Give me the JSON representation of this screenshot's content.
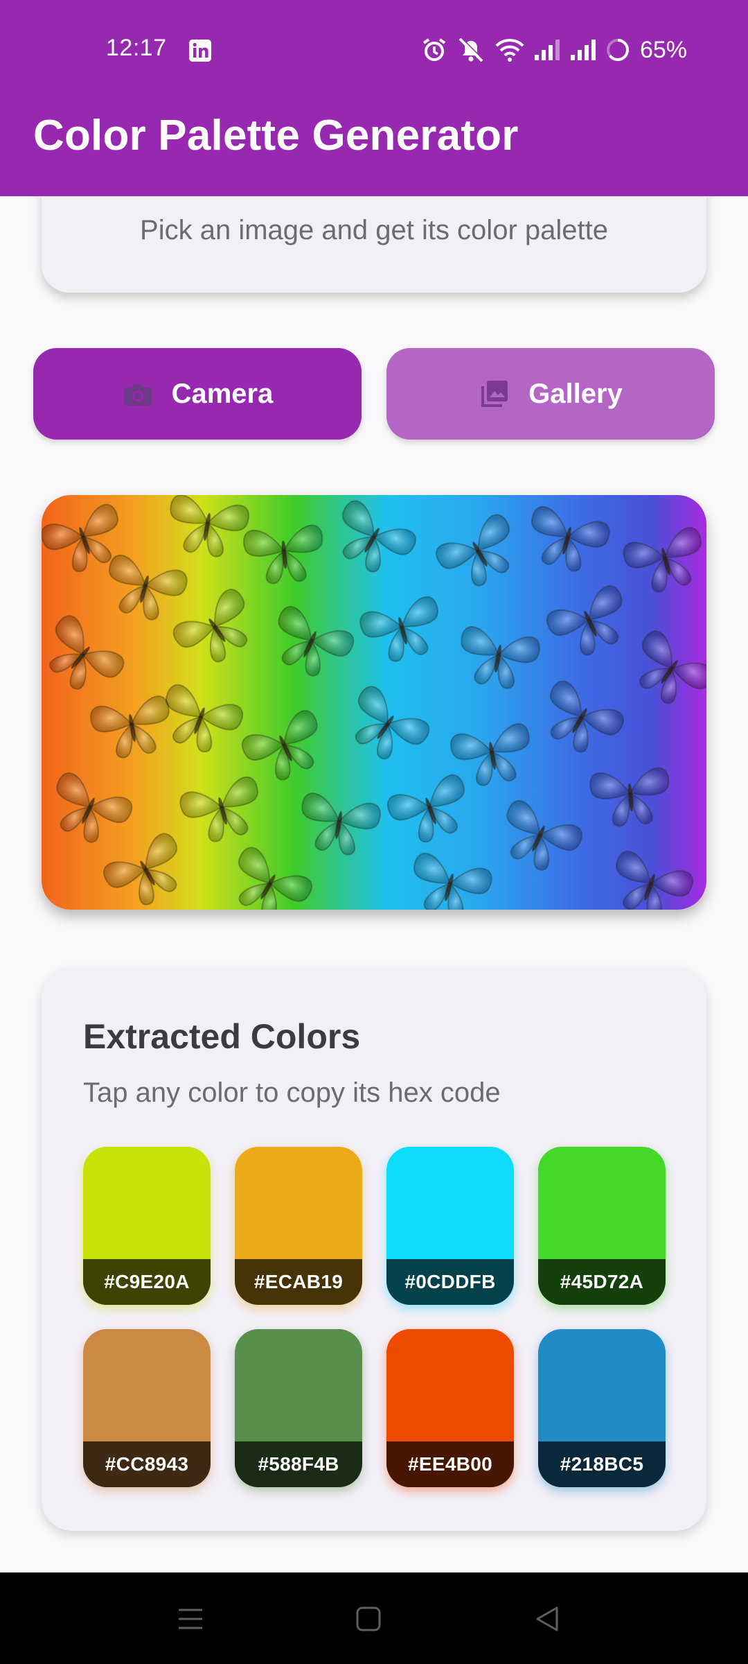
{
  "status_bar": {
    "time": "12:17",
    "battery": "65%"
  },
  "app_bar": {
    "title": "Color Palette Generator"
  },
  "intro": {
    "subtitle": "Pick an image and get its color palette"
  },
  "actions": {
    "camera_label": "Camera",
    "camera_icon": "camera-icon",
    "gallery_label": "Gallery",
    "gallery_icon": "photo-library-icon"
  },
  "preview": {
    "content": "rainbow-butterflies-photo"
  },
  "palette": {
    "title": "Extracted Colors",
    "subtitle": "Tap any color to copy its hex code",
    "colors": [
      {
        "hex": "#C9E20A"
      },
      {
        "hex": "#ECAB19"
      },
      {
        "hex": "#0CDDFB"
      },
      {
        "hex": "#45D72A"
      },
      {
        "hex": "#CC8943"
      },
      {
        "hex": "#588F4B"
      },
      {
        "hex": "#EE4B00"
      },
      {
        "hex": "#218BC5"
      }
    ]
  },
  "colors": {
    "primary": "#9728b0",
    "primary_light": "#b366c6",
    "card_background": "#f3eff7",
    "page_background": "#f9f8fa"
  }
}
